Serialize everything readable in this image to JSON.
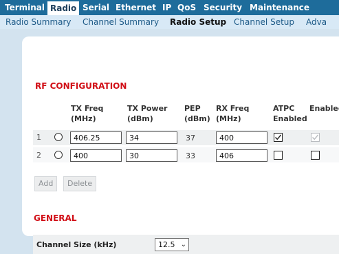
{
  "topnav": {
    "tabs": [
      "Terminal",
      "Radio",
      "Serial",
      "Ethernet",
      "IP",
      "QoS",
      "Security",
      "Maintenance"
    ],
    "active": "Radio"
  },
  "subnav": {
    "items": [
      "Radio Summary",
      "Channel Summary",
      "Radio Setup",
      "Channel Setup",
      "Adva"
    ],
    "active": "Radio Setup"
  },
  "rf": {
    "title": "RF CONFIGURATION",
    "headers": {
      "tx_freq": [
        "TX Freq",
        "(MHz)"
      ],
      "tx_power": [
        "TX Power",
        "(dBm)"
      ],
      "pep": [
        "PEP",
        "(dBm)"
      ],
      "rx_freq": [
        "RX Freq",
        "(MHz)"
      ],
      "atpc": [
        "ATPC",
        "Enabled"
      ],
      "enabled": [
        "Enabled",
        ""
      ]
    },
    "rows": [
      {
        "num": "1",
        "tx_freq": "406.25",
        "tx_power": "34",
        "pep": "37",
        "rx_freq": "400",
        "atpc": true,
        "enabled": true,
        "enabled_disabled": true
      },
      {
        "num": "2",
        "tx_freq": "400",
        "tx_power": "30",
        "pep": "33",
        "rx_freq": "406",
        "atpc": false,
        "enabled": false,
        "enabled_disabled": false
      }
    ],
    "add_label": "Add",
    "delete_label": "Delete"
  },
  "general": {
    "title": "GENERAL",
    "channel_size_label": "Channel Size (kHz)",
    "channel_size_value": "12.5"
  },
  "colors": {
    "nav_bg": "#1e6c9b",
    "subnav_bg": "#d8e9f6",
    "page_bg": "#d3e3ef",
    "section_title": "#d10e16"
  }
}
